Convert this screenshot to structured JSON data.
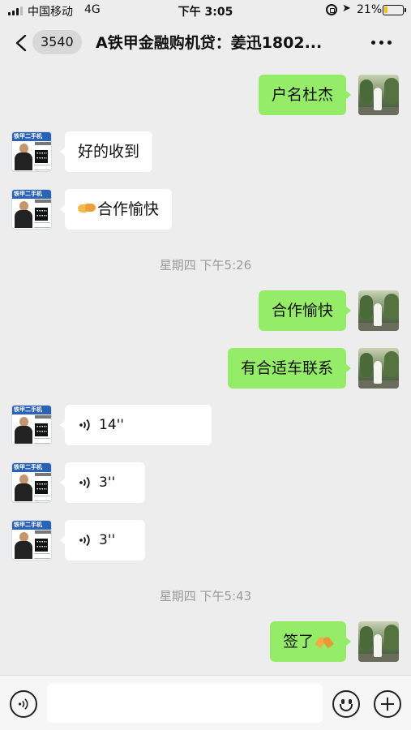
{
  "status_bar": {
    "carrier": "中国移动",
    "network": "4G",
    "time": "下午 3:05",
    "battery_pct": "21%",
    "battery_level": 0.21,
    "icons": [
      "signal-icon",
      "orientation-lock-icon",
      "location-icon",
      "battery-icon"
    ]
  },
  "header": {
    "unread_count": "3540",
    "title": "A铁甲金融购机贷：姜迅1802..."
  },
  "avatars": {
    "other_card_text": "铁甲二手机"
  },
  "messages": [
    {
      "sender": "self",
      "type": "text",
      "text": "户名杜杰"
    },
    {
      "sender": "other",
      "type": "text",
      "text": "好的收到"
    },
    {
      "sender": "other",
      "type": "text",
      "emoji": "handshake-emoji",
      "text": "合作愉快"
    },
    {
      "type": "time",
      "text": "星期四 下午5:26"
    },
    {
      "sender": "self",
      "type": "text",
      "text": "合作愉快"
    },
    {
      "sender": "self",
      "type": "text",
      "text": "有合适车联系"
    },
    {
      "sender": "other",
      "type": "voice",
      "duration": "14''"
    },
    {
      "sender": "other",
      "type": "voice",
      "duration": "3''"
    },
    {
      "sender": "other",
      "type": "voice",
      "duration": "3''"
    },
    {
      "type": "time",
      "text": "星期四 下午5:43"
    },
    {
      "sender": "self",
      "type": "text",
      "text": "签了",
      "emoji": "pray-emoji"
    }
  ],
  "input_bar": {
    "value": "",
    "icons": [
      "voice-mode-icon",
      "emoji-icon",
      "plus-icon"
    ]
  },
  "colors": {
    "background": "#ededed",
    "self_bubble": "#95ec69",
    "other_bubble": "#ffffff",
    "timestamp": "#9a9a9a"
  }
}
